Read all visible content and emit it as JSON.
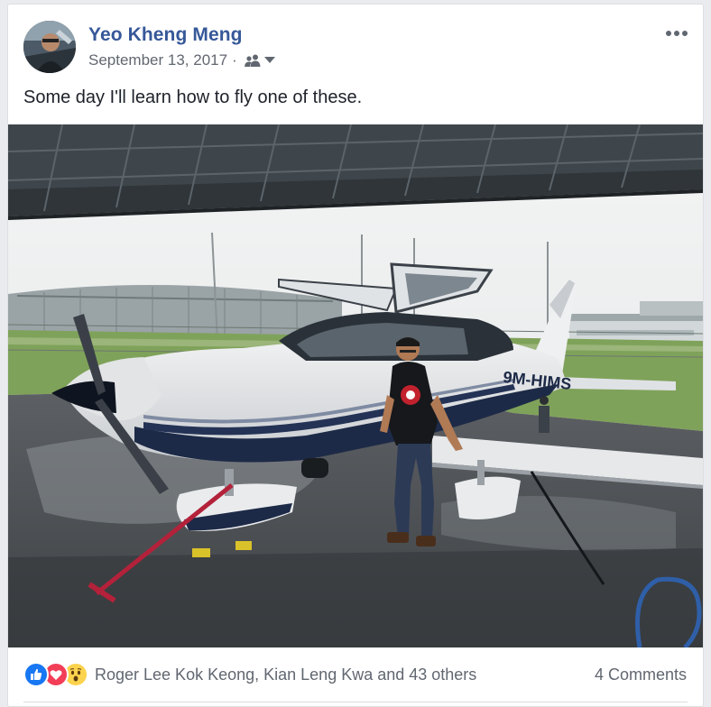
{
  "post": {
    "author": "Yeo Kheng Meng",
    "date": "September 13, 2017",
    "separator": "·",
    "audience_icon": "friends-icon",
    "dropdown_icon": "caret-down-icon",
    "more_icon": "more-options-icon",
    "text": "Some day I'll learn how to fly one of these."
  },
  "photo": {
    "aircraft_registration": "9M-HIMS",
    "description_icon": "post-photo"
  },
  "reactions": {
    "icons": [
      "like-icon",
      "love-icon",
      "wow-icon"
    ],
    "names": "Roger Lee Kok Keong, Kian Leng Kwa and 43 others",
    "comments": "4 Comments"
  },
  "colors": {
    "author_link": "#365899",
    "meta_text": "#616770",
    "body_text": "#1d2129",
    "like_blue": "#1877f2",
    "love_red": "#f33e58",
    "wow_yellow": "#fcd34d"
  }
}
